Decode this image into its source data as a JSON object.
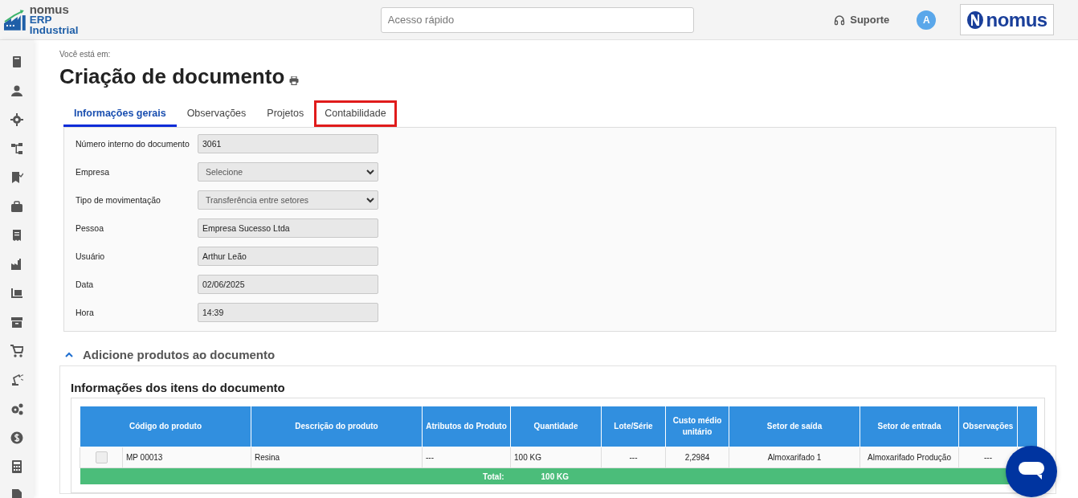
{
  "header": {
    "logo_brand": "nomus",
    "logo_product": "ERP Industrial",
    "quick_access": {
      "placeholder": "Acesso rápido"
    },
    "support": "Suporte",
    "avatar": "A",
    "brand_logo": "nomus"
  },
  "breadcrumb_label": "Você está em:",
  "title": "Criação de documento",
  "tabs": [
    {
      "label": "Informações gerais",
      "selected": true,
      "highlighted": false
    },
    {
      "label": "Observações",
      "selected": false,
      "highlighted": false
    },
    {
      "label": "Projetos",
      "selected": false,
      "highlighted": false
    },
    {
      "label": "Contabilidade",
      "selected": false,
      "highlighted": true
    }
  ],
  "form": {
    "fields": [
      {
        "label": "Número interno do documento",
        "kind": "input",
        "value": "3061"
      },
      {
        "label": "Empresa",
        "kind": "select",
        "value": "Selecione"
      },
      {
        "label": "Tipo de movimentação",
        "kind": "select",
        "value": "Transferência entre setores"
      },
      {
        "label": "Pessoa",
        "kind": "input",
        "value": "Empresa Sucesso Ltda"
      },
      {
        "label": "Usuário",
        "kind": "input",
        "value": "Arthur Leão"
      },
      {
        "label": "Data",
        "kind": "input",
        "value": "02/06/2025"
      },
      {
        "label": "Hora",
        "kind": "input",
        "value": "14:39"
      }
    ]
  },
  "products_section": {
    "title": "Adicione produtos ao documento",
    "expanded": true,
    "table_title": "Informações dos itens do documento",
    "columns": [
      "Código do produto",
      "Descrição do produto",
      "Atributos do Produto",
      "Quantidade",
      "Lote/Série",
      "Custo médio unitário",
      "Setor de saída",
      "Setor de entrada",
      "Observações"
    ],
    "rows": [
      {
        "checked": false,
        "cells": [
          "MP 00013",
          "Resina",
          "---",
          "100 KG",
          "---",
          "2,2984",
          "Almoxarifado 1",
          "Almoxarifado Produção",
          "---"
        ]
      }
    ],
    "total": {
      "label": "Total:",
      "value": "100 KG"
    }
  }
}
